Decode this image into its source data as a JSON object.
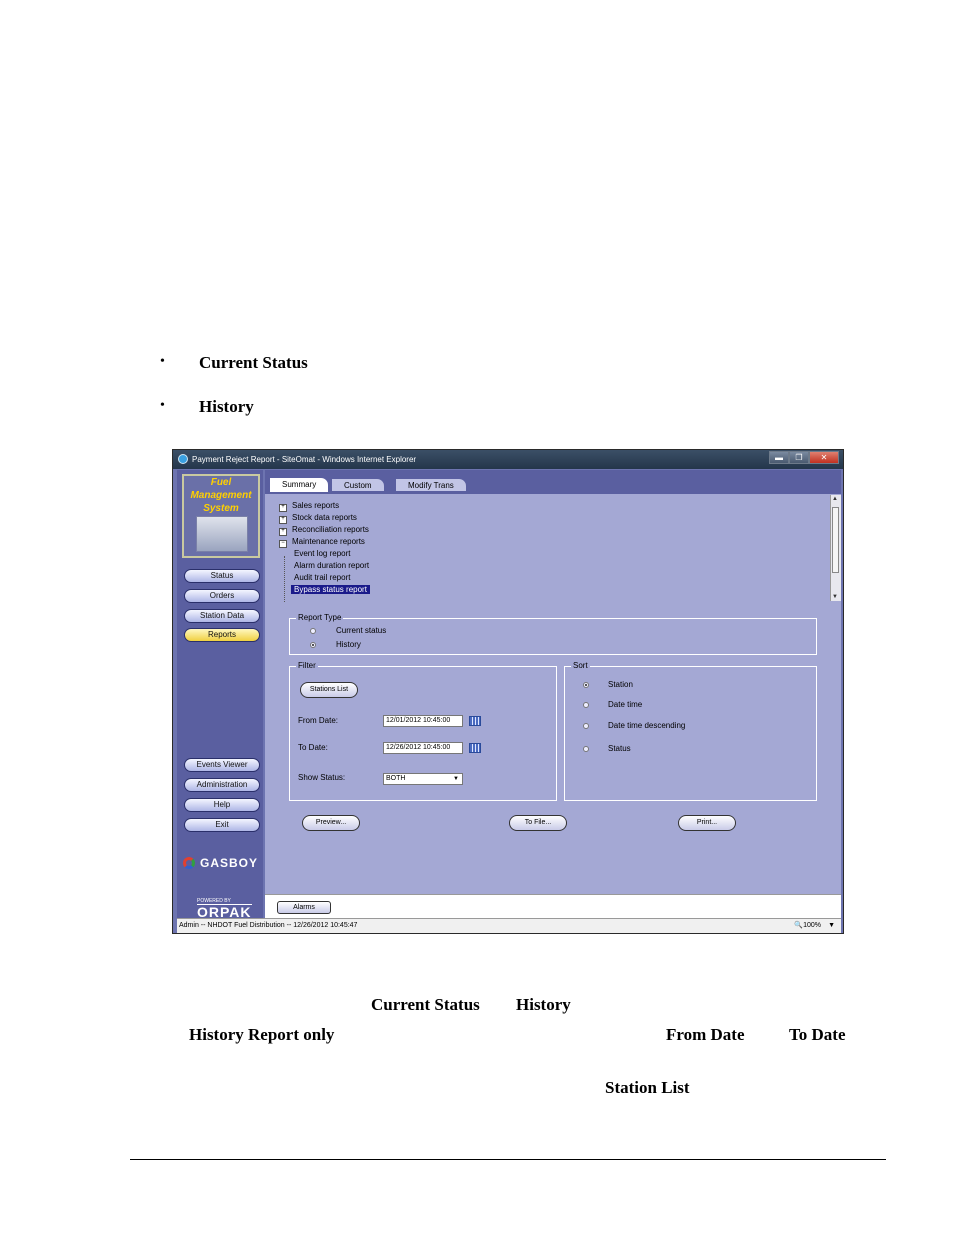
{
  "doc": {
    "bullets": [
      {
        "symbol": "•",
        "label": "Current Status"
      },
      {
        "symbol": "•",
        "label": "History"
      }
    ],
    "bold_terms": {
      "current_status": "Current Status",
      "history": "History",
      "history_report_only": "History Report only",
      "from_date": "From Date",
      "to_date": "To Date",
      "station_list": "Station List"
    }
  },
  "window": {
    "title": "Payment Reject Report - SiteOmat - Windows Internet Explorer",
    "buttons": {
      "minimize": "▬",
      "maximize": "❐",
      "close": "✕"
    }
  },
  "sidebar": {
    "logo_lines": [
      "Fuel",
      "Management",
      "System"
    ],
    "nav": {
      "status": "Status",
      "orders": "Orders",
      "station_data": "Station Data",
      "reports": "Reports",
      "events_viewer": "Events Viewer",
      "administration": "Administration",
      "help": "Help",
      "exit": "Exit"
    },
    "gasboy": "GASBOY",
    "powered_by": "POWERED BY",
    "orpak": "ORPAK"
  },
  "tabs": {
    "summary": "Summary",
    "custom": "Custom",
    "modify_trans": "Modify Trans"
  },
  "tree": {
    "exp_plus": "+",
    "exp_minus": "−",
    "sales": "Sales reports",
    "stock": "Stock data reports",
    "reconciliation": "Reconciliation reports",
    "maintenance": "Maintenance reports",
    "event_log": "Event log report",
    "alarm_duration": "Alarm duration report",
    "audit_trail": "Audit trail report",
    "bypass_status": "Bypass status report"
  },
  "report_type": {
    "title": "Report Type",
    "current_status": "Current status",
    "history": "History",
    "selected": "History"
  },
  "filter": {
    "title": "Filter",
    "stations_list": "Stations List",
    "from_date_label": "From Date:",
    "from_date_value": "12/01/2012 10:45:00",
    "to_date_label": "To Date:",
    "to_date_value": "12/26/2012 10:45:00",
    "show_status_label": "Show Status:",
    "show_status_value": "BOTH"
  },
  "sort": {
    "title": "Sort",
    "station": "Station",
    "date_time": "Date time",
    "date_time_desc": "Date time descending",
    "status": "Status",
    "selected": "Station"
  },
  "actions": {
    "preview": "Preview...",
    "to_file": "To File...",
    "print": "Print..."
  },
  "alarms": "Alarms",
  "statusbar": {
    "text": "Admin -- NHDOT Fuel Distribution -- 12/26/2012 10:45:47",
    "zoom": "100%"
  }
}
